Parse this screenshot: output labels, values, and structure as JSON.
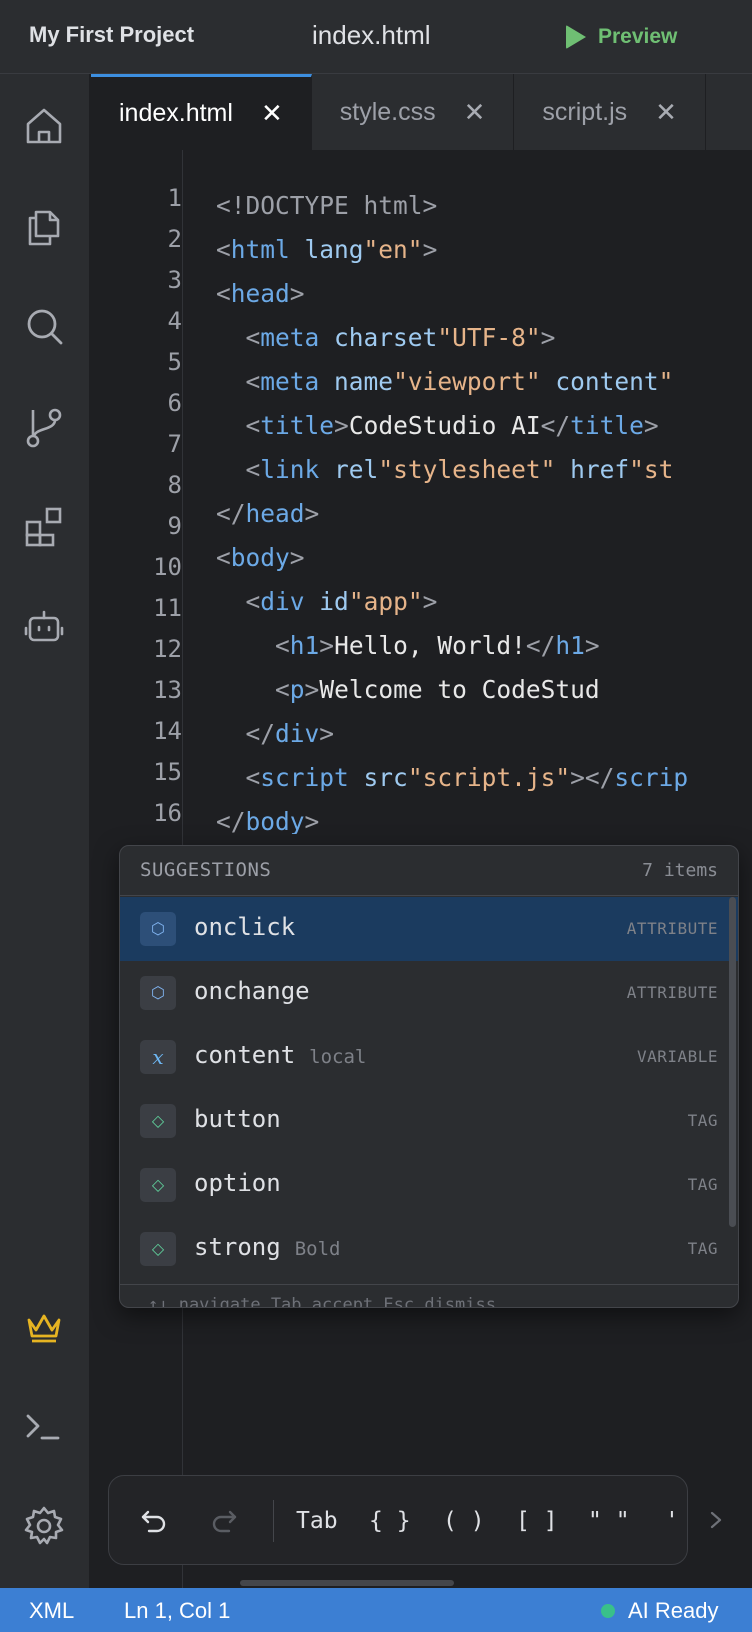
{
  "titlebar": {
    "project": "My First Project",
    "filename": "index.html",
    "preview_label": "Preview"
  },
  "activitybar": {
    "items": [
      "home-icon",
      "files-icon",
      "search-icon",
      "source-control-icon",
      "extensions-icon",
      "ai-bot-icon",
      "crown-icon",
      "terminal-icon",
      "settings-icon"
    ]
  },
  "tabs": [
    {
      "label": "index.html",
      "active": true
    },
    {
      "label": "style.css",
      "active": false
    },
    {
      "label": "script.js",
      "active": false
    }
  ],
  "tab_close": "✕",
  "editor": {
    "line_numbers": [
      "1",
      "2",
      "3",
      "4",
      "5",
      "6",
      "7",
      "8",
      "9",
      "10",
      "11",
      "12",
      "13",
      "14",
      "15",
      "16"
    ],
    "lines": [
      "<!DOCTYPE html>",
      "<html lang=\"en\">",
      "<head>",
      "  <meta charset=\"UTF-8\">",
      "  <meta name=\"viewport\" content=\"",
      "  <title>CodeStudio AI</title>",
      "  <link rel=\"stylesheet\" href=\"st",
      "</head>",
      "<body>",
      "  <div id=\"app\">",
      "    <h1>Hello, World!</h1>",
      "    <p>Welcome to CodeStud",
      "  </div>",
      "  <script src=\"script.js\"></scrip",
      "</body>"
    ]
  },
  "suggestions": {
    "title": "SUGGESTIONS",
    "count": "7 items",
    "items": [
      {
        "name": "onclick",
        "hint": "",
        "kind": "ATTRIBUTE",
        "icon": "⬡",
        "icon_color": "#7fb2ee",
        "selected": true
      },
      {
        "name": "onchange",
        "hint": "",
        "kind": "ATTRIBUTE",
        "icon": "⬡",
        "icon_color": "#7fb2ee",
        "selected": false
      },
      {
        "name": "content",
        "hint": "local",
        "kind": "VARIABLE",
        "icon": "x",
        "icon_color": "#6db5f0",
        "selected": false
      },
      {
        "name": "button",
        "hint": "",
        "kind": "TAG",
        "icon": "◇",
        "icon_color": "#5fcf9b",
        "selected": false
      },
      {
        "name": "option",
        "hint": "",
        "kind": "TAG",
        "icon": "◇",
        "icon_color": "#5fcf9b",
        "selected": false
      },
      {
        "name": "strong",
        "hint": "Bold",
        "kind": "TAG",
        "icon": "◇",
        "icon_color": "#5fcf9b",
        "selected": false
      }
    ],
    "footer": "↑↓ navigate  Tab accept  Esc dismiss"
  },
  "keybar": {
    "keys": [
      "Tab",
      "{ }",
      "( )",
      "[ ]",
      "\" \"",
      "'"
    ]
  },
  "statusbar": {
    "language": "XML",
    "position": "Ln 1, Col 1",
    "ai_status": "AI Ready"
  },
  "colors": {
    "accent": "#3c7fd3",
    "preview": "#6fbf73",
    "crown": "#e6b422",
    "ai_dot": "#39c08a"
  }
}
